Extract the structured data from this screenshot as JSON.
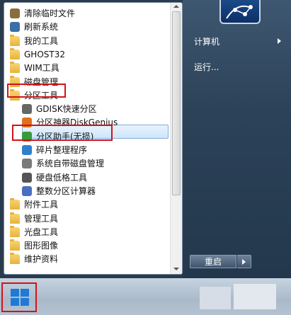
{
  "start_menu": {
    "programs": [
      {
        "label": "清除临时文件",
        "icon": "broom-icon",
        "indent": false
      },
      {
        "label": "刷新系统",
        "icon": "refresh-monitor-icon",
        "indent": false
      },
      {
        "label": "我的工具",
        "icon": "folder-icon",
        "indent": false
      },
      {
        "label": "GHOST32",
        "icon": "folder-icon",
        "indent": false
      },
      {
        "label": "WIM工具",
        "icon": "folder-icon",
        "indent": false
      },
      {
        "label": "磁盘管理",
        "icon": "folder-icon",
        "indent": false
      },
      {
        "label": "分区工具",
        "icon": "folder-icon",
        "indent": false,
        "highlighted": true
      },
      {
        "label": "GDISK快速分区",
        "icon": "disk-tool-icon",
        "indent": true
      },
      {
        "label": "分区神器DiskGenius",
        "icon": "diskgenius-icon",
        "indent": true
      },
      {
        "label": "分区助手(无损)",
        "icon": "partition-assistant-icon",
        "indent": true,
        "selected": true,
        "highlighted": true
      },
      {
        "label": "碎片整理程序",
        "icon": "defrag-icon",
        "indent": true
      },
      {
        "label": "系统自带磁盘管理",
        "icon": "disk-management-icon",
        "indent": true
      },
      {
        "label": "硬盘低格工具",
        "icon": "hdd-format-icon",
        "indent": true
      },
      {
        "label": "整数分区计算器",
        "icon": "calculator-icon",
        "indent": true
      },
      {
        "label": "附件工具",
        "icon": "folder-icon",
        "indent": false
      },
      {
        "label": "管理工具",
        "icon": "folder-icon",
        "indent": false
      },
      {
        "label": "光盘工具",
        "icon": "folder-icon",
        "indent": false
      },
      {
        "label": "图形图像",
        "icon": "folder-icon",
        "indent": false
      },
      {
        "label": "维护资料",
        "icon": "folder-icon",
        "indent": false
      }
    ],
    "right_items": {
      "computer": "计算机",
      "run": "运行..."
    },
    "shutdown_label": "重启"
  },
  "colors": {
    "highlight_border": "#d0141a",
    "selection_fill": "#cfe5fa",
    "windows_blue": "#1f7ad6"
  }
}
